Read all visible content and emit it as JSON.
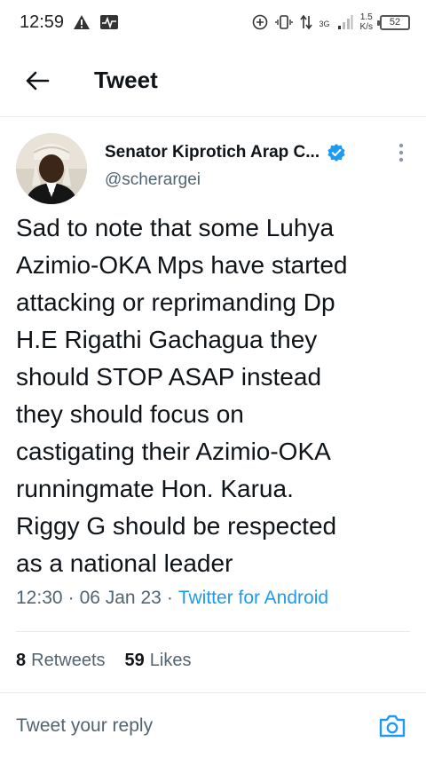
{
  "status_bar": {
    "time": "12:59",
    "network": "3G",
    "speed_value": "1.5",
    "speed_unit": "K/s",
    "battery": "52"
  },
  "header": {
    "title": "Tweet"
  },
  "tweet": {
    "author_name": "Senator Kiprotich Arap C...",
    "handle": "@scherargei",
    "text": "Sad to note that some Luhya\nAzimio-OKA Mps have started\nattacking or reprimanding Dp\nH.E Rigathi Gachagua they\nshould STOP ASAP instead\nthey should focus on\ncastigating their  Azimio-OKA\nrunningmate Hon. Karua.\nRiggy G should be respected\nas a national leader",
    "time": "12:30",
    "date": "06 Jan 23",
    "source": "Twitter for Android",
    "separator": "·"
  },
  "stats": {
    "retweets_count": "8",
    "retweets_label": "Retweets",
    "likes_count": "59",
    "likes_label": "Likes"
  },
  "reply": {
    "placeholder": "Tweet your reply"
  },
  "colors": {
    "accent": "#1d9bf0",
    "text_primary": "#0f1419",
    "text_secondary": "#536471"
  }
}
